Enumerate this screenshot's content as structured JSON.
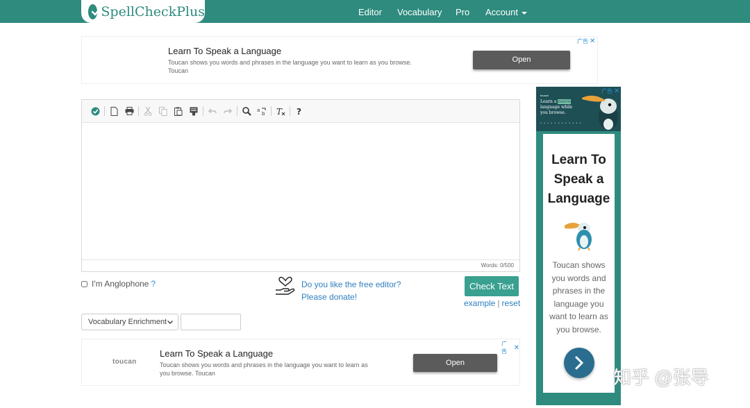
{
  "nav": {
    "brand": "SpellCheckPlus",
    "links": [
      "Editor",
      "Vocabulary",
      "Pro",
      "Account"
    ]
  },
  "ad_top": {
    "title": "Learn To Speak a Language",
    "desc_line1": "Toucan shows you words and phrases in the language you want to learn as you browse.",
    "desc_line2": "Toucan",
    "open": "Open",
    "adchoice": "广告"
  },
  "editor": {
    "word_count": "Words: 0/500",
    "toolbar_icons": [
      "check-icon",
      "new-document-icon",
      "print-icon",
      "cut-icon",
      "copy-icon",
      "paste-icon",
      "paste-text-icon",
      "undo-icon",
      "redo-icon",
      "find-icon",
      "replace-icon",
      "remove-format-icon",
      "help-icon"
    ]
  },
  "controls": {
    "anglophone_label": "I'm Anglophone",
    "anglophone_help": "?",
    "donate_line1": "Do you like the free editor?",
    "donate_line2": "Please donate!",
    "check_button": "Check Text",
    "example_link": "example",
    "link_sep": "|",
    "reset_link": "reset",
    "vocab_select": "Vocabulary Enrichment",
    "vocab_input_value": ""
  },
  "ad_bottom": {
    "brand": "toucan",
    "title": "Learn To Speak a Language",
    "desc_line1": "Toucan shows you words and phrases in the language you want to learn as",
    "desc_line2": "you browse. Toucan",
    "open": "Open",
    "adchoice": "广告"
  },
  "side_ad": {
    "adchoice": "广告",
    "head_brand": "toucan",
    "head_line1": "Learn a",
    "head_highlight": "nuevo",
    "head_line2": "language while",
    "head_line3": "you browse.",
    "title_line1": "Learn To",
    "title_line2": "Speak a",
    "title_line3": "Language",
    "desc_line1": "Toucan shows",
    "desc_line2": "you words and",
    "desc_line3": "phrases in the",
    "desc_line4": "language you",
    "desc_line5": "want to learn as",
    "desc_line6": "you browse."
  },
  "watermark": "知乎 @张导",
  "colors": {
    "brand_teal": "#2e8b7e",
    "link_blue": "#2e7fbf",
    "check_button": "#3aa090",
    "ad_button": "#5b5b5b",
    "side_arrow": "#2a6d8f"
  }
}
